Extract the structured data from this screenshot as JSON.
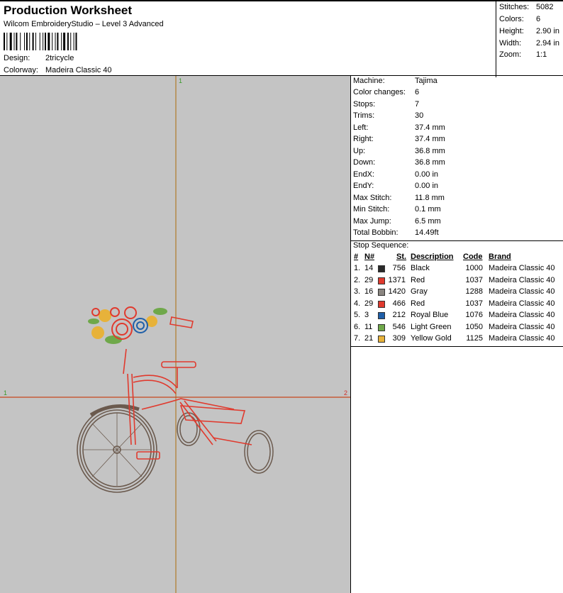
{
  "header": {
    "title": "Production Worksheet",
    "software": "Wilcom EmbroideryStudio – Level 3 Advanced",
    "design_label": "Design:",
    "design_value": "2tricycle",
    "colorway_label": "Colorway:",
    "colorway_value": "Madeira Classic 40"
  },
  "summary": [
    {
      "label": "Stitches:",
      "value": "5082"
    },
    {
      "label": "Colors:",
      "value": "6"
    },
    {
      "label": "Height:",
      "value": "2.90 in"
    },
    {
      "label": "Width:",
      "value": "2.94 in"
    },
    {
      "label": "Zoom:",
      "value": "1:1"
    }
  ],
  "canvas": {
    "marker_top": "1",
    "marker_left": "1",
    "marker_right": "2"
  },
  "details": [
    {
      "label": "Machine:",
      "value": "Tajima"
    },
    {
      "label": "Color changes:",
      "value": "6"
    },
    {
      "label": "Stops:",
      "value": "7"
    },
    {
      "label": "Trims:",
      "value": "30"
    },
    {
      "label": "Left:",
      "value": "37.4 mm"
    },
    {
      "label": "Right:",
      "value": "37.4 mm"
    },
    {
      "label": "Up:",
      "value": "36.8 mm"
    },
    {
      "label": "Down:",
      "value": "36.8 mm"
    },
    {
      "label": "EndX:",
      "value": "0.00 in"
    },
    {
      "label": "EndY:",
      "value": "0.00 in"
    },
    {
      "label": "Max Stitch:",
      "value": "11.8 mm"
    },
    {
      "label": "Min Stitch:",
      "value": "0.1 mm"
    },
    {
      "label": "Max Jump:",
      "value": "6.5 mm"
    },
    {
      "label": "Total Bobbin:",
      "value": "14.49ft"
    }
  ],
  "sequence": {
    "title": "Stop Sequence:",
    "headers": {
      "num": "#",
      "needle": "N#",
      "stitches": "St.",
      "description": "Description",
      "code": "Code",
      "brand": "Brand"
    },
    "rows": [
      {
        "num": "1.",
        "needle": "14",
        "color": "#2a2a2a",
        "stitches": "756",
        "description": "Black",
        "code": "1000",
        "brand": "Madeira Classic 40"
      },
      {
        "num": "2.",
        "needle": "29",
        "color": "#e03a2e",
        "stitches": "1371",
        "description": "Red",
        "code": "1037",
        "brand": "Madeira Classic 40"
      },
      {
        "num": "3.",
        "needle": "16",
        "color": "#8a8580",
        "stitches": "1420",
        "description": "Gray",
        "code": "1288",
        "brand": "Madeira Classic 40"
      },
      {
        "num": "4.",
        "needle": "29",
        "color": "#e03a2e",
        "stitches": "466",
        "description": "Red",
        "code": "1037",
        "brand": "Madeira Classic 40"
      },
      {
        "num": "5.",
        "needle": "3",
        "color": "#1f5fa8",
        "stitches": "212",
        "description": "Royal Blue",
        "code": "1076",
        "brand": "Madeira Classic 40"
      },
      {
        "num": "6.",
        "needle": "11",
        "color": "#6fa84a",
        "stitches": "546",
        "description": "Light Green",
        "code": "1050",
        "brand": "Madeira Classic 40"
      },
      {
        "num": "7.",
        "needle": "21",
        "color": "#e7b23a",
        "stitches": "309",
        "description": "Yellow Gold",
        "code": "1125",
        "brand": "Madeira Classic 40"
      }
    ]
  }
}
